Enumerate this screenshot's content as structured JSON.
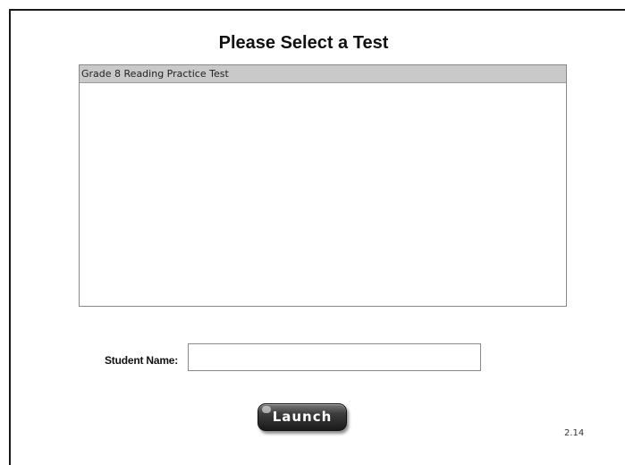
{
  "page": {
    "title": "Please Select a Test",
    "version": "2.14"
  },
  "test_list": {
    "items": [
      {
        "label": "Grade 8 Reading Practice Test",
        "selected": true
      }
    ]
  },
  "student": {
    "label": "Student Name:",
    "value": "",
    "placeholder": ""
  },
  "actions": {
    "launch_label": "Launch"
  },
  "colors": {
    "selected_row": "#c9c9c9",
    "button_dark": "#2a2a2a",
    "border": "#8a8a8a"
  }
}
